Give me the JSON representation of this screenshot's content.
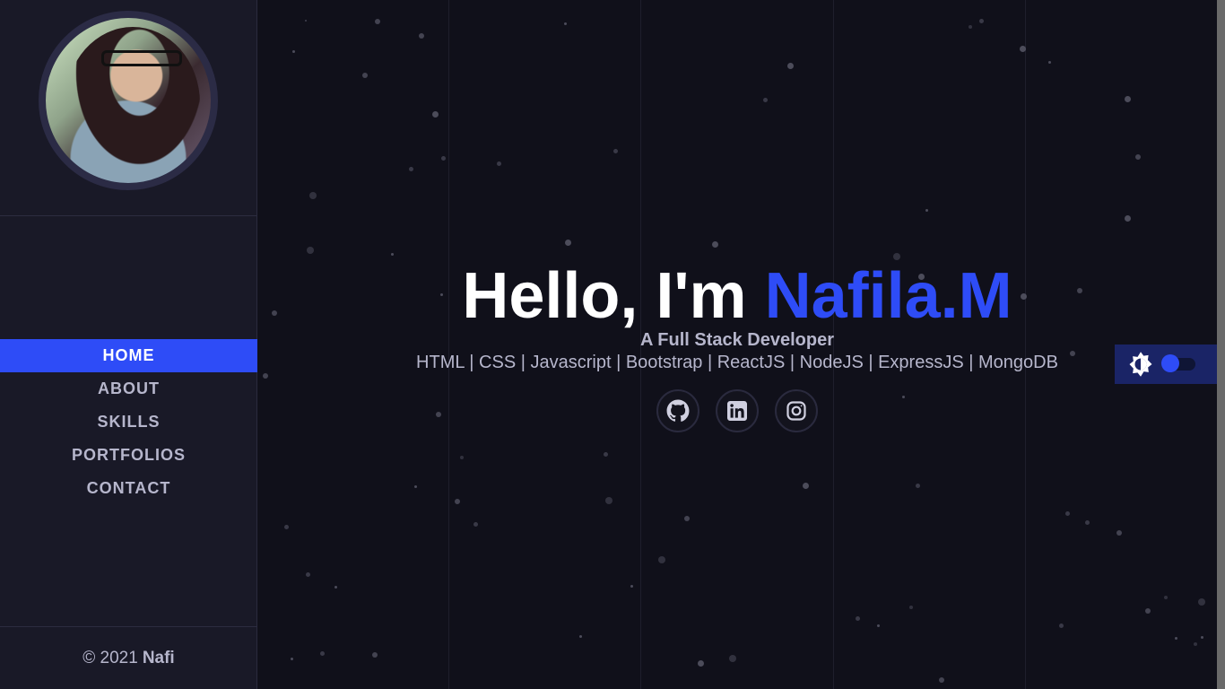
{
  "sidebar": {
    "avatar_alt": "Profile photo",
    "nav": {
      "home": "HOME",
      "about": "ABOUT",
      "skills": "SKILLS",
      "portfolios": "PORTFOLIOS",
      "contact": "CONTACT"
    },
    "active_item": "HOME",
    "footer": {
      "copyright": "© 2021",
      "author": "Nafi"
    }
  },
  "hero": {
    "greeting": "Hello, I'm",
    "name": "Nafila.M",
    "role": "A Full Stack Developer",
    "skills": "HTML | CSS | Javascript | Bootstrap | ReactJS | NodeJS | ExpressJS | MongoDB",
    "socials": [
      "github-icon",
      "linkedin-icon",
      "instagram-icon"
    ]
  },
  "theme_toggle": {
    "icon": "brightness-icon",
    "state": "dark"
  },
  "colors": {
    "accent": "#2e4cf7",
    "background": "#10101a",
    "sidebar": "#191927",
    "text_muted": "#b6b6cc"
  }
}
